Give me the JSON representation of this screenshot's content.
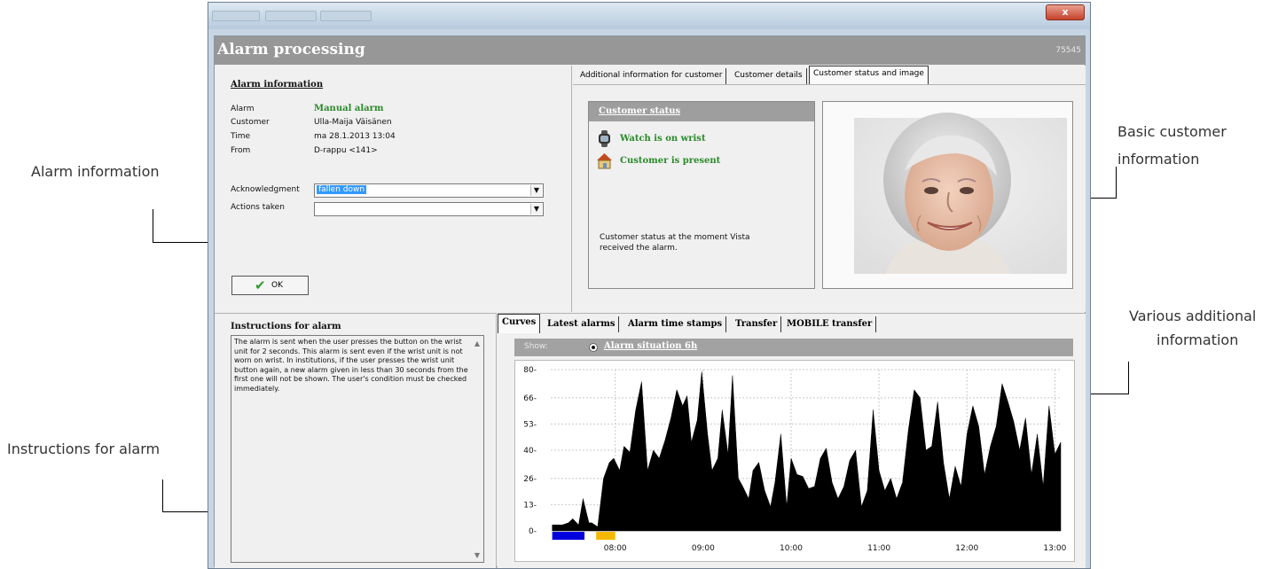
{
  "callouts": {
    "alarm_information": "Alarm information",
    "instructions_for_alarm": "Instructions for alarm",
    "basic_customer_information_1": "Basic customer",
    "basic_customer_information_2": "information",
    "various_additional_1": "Various additional",
    "various_additional_2": "information"
  },
  "window": {
    "close_label": "x"
  },
  "header": {
    "title": "Alarm processing",
    "id": "75545"
  },
  "alarm_info": {
    "section_title": "Alarm information",
    "rows": [
      {
        "label": "Alarm",
        "value": "Manual alarm"
      },
      {
        "label": "Customer",
        "value": "Ulla-Maija Väisänen"
      },
      {
        "label": "Time",
        "value": "ma 28.1.2013 13:04"
      },
      {
        "label": "From",
        "value": "D-rappu  <141>"
      }
    ],
    "acknowledgment_label": "Acknowledgment",
    "acknowledgment_value": "fallen down",
    "actions_label": "Actions taken",
    "actions_value": "",
    "ok_label": "OK"
  },
  "customer_tabs": [
    {
      "label": "Additional information for customer",
      "active": false
    },
    {
      "label": "Customer details",
      "active": false
    },
    {
      "label": "Customer status and image",
      "active": true
    }
  ],
  "customer_status": {
    "title": "Customer status",
    "items": [
      {
        "icon": "watch-icon",
        "label": "Watch is on wrist"
      },
      {
        "icon": "home-icon",
        "label": "Customer is present"
      }
    ],
    "note": "Customer status at the moment Vista received the alarm."
  },
  "instructions": {
    "title": "Instructions for alarm",
    "text": "The alarm is sent when the user presses the button on the wrist unit for 2 seconds. This alarm is sent even if the wrist unit is not worn on wrist. In institutions, if the user presses the wrist unit button again, a new alarm given in less than 30 seconds from the first one will not be shown. The user's condition must be checked immediately."
  },
  "bottom_tabs": [
    {
      "label": "Curves",
      "active": true
    },
    {
      "label": "Latest alarms",
      "active": false
    },
    {
      "label": "Alarm time stamps",
      "active": false
    },
    {
      "label": "Transfer",
      "active": false
    },
    {
      "label": "MOBILE transfer",
      "active": false
    }
  ],
  "show_bar": {
    "label": "Show:",
    "option": "Alarm situation 6h"
  },
  "chart_data": {
    "type": "area",
    "title": "",
    "xlabel": "",
    "ylabel": "",
    "ylim": [
      0,
      80
    ],
    "xlim": [
      "07:16",
      "13:04"
    ],
    "yticks": [
      0,
      13,
      26,
      40,
      53,
      66,
      80
    ],
    "xticks": [
      "08:00",
      "09:00",
      "10:00",
      "11:00",
      "12:00",
      "13:00"
    ],
    "grid": true,
    "fill_color": "#000000",
    "x": [
      "07:17",
      "07:24",
      "07:28",
      "07:31",
      "07:35",
      "07:38",
      "07:42",
      "07:44",
      "07:48",
      "07:52",
      "07:56",
      "07:59",
      "08:03",
      "08:06",
      "08:10",
      "08:14",
      "08:18",
      "08:22",
      "08:26",
      "08:30",
      "08:34",
      "08:38",
      "08:42",
      "08:46",
      "08:49",
      "08:52",
      "08:56",
      "08:59",
      "09:03",
      "09:06",
      "09:10",
      "09:13",
      "09:17",
      "09:20",
      "09:24",
      "09:27",
      "09:31",
      "09:34",
      "09:38",
      "09:42",
      "09:46",
      "09:49",
      "09:53",
      "09:57",
      "10:00",
      "10:04",
      "10:08",
      "10:12",
      "10:16",
      "10:20",
      "10:24",
      "10:28",
      "10:32",
      "10:36",
      "10:40",
      "10:44",
      "10:48",
      "10:52",
      "10:56",
      "11:00",
      "11:04",
      "11:08",
      "11:12",
      "11:16",
      "11:20",
      "11:24",
      "11:28",
      "11:32",
      "11:36",
      "11:40",
      "11:44",
      "11:48",
      "11:52",
      "11:56",
      "12:00",
      "12:04",
      "12:08",
      "12:12",
      "12:16",
      "12:20",
      "12:24",
      "12:28",
      "12:32",
      "12:36",
      "12:40",
      "12:44",
      "12:48",
      "12:52",
      "12:56",
      "13:00",
      "13:04"
    ],
    "values": [
      3,
      3,
      4,
      6,
      3,
      16,
      4,
      4,
      2,
      26,
      34,
      36,
      30,
      42,
      39,
      60,
      74,
      30,
      40,
      36,
      45,
      56,
      70,
      62,
      67,
      44,
      55,
      79,
      48,
      30,
      36,
      60,
      38,
      77,
      26,
      22,
      16,
      30,
      34,
      20,
      12,
      24,
      48,
      12,
      36,
      28,
      27,
      21,
      22,
      36,
      41,
      24,
      16,
      22,
      35,
      40,
      12,
      20,
      60,
      30,
      20,
      26,
      16,
      24,
      50,
      70,
      66,
      40,
      42,
      64,
      34,
      16,
      32,
      22,
      48,
      62,
      52,
      28,
      42,
      52,
      73,
      64,
      54,
      40,
      56,
      28,
      48,
      22,
      62,
      38,
      44
    ],
    "markers": [
      {
        "color": "#0000dd",
        "from": "07:17",
        "to": "07:39"
      },
      {
        "color": "#f5b800",
        "from": "07:47",
        "to": "08:00"
      }
    ]
  }
}
